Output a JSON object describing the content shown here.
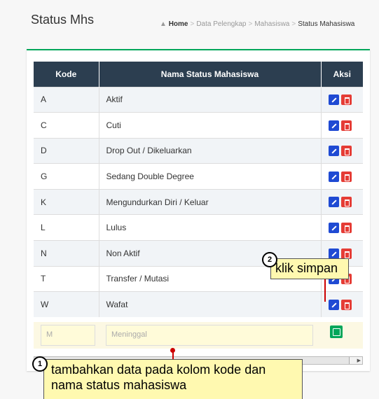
{
  "page": {
    "title": "Status Mhs"
  },
  "breadcrumb": [
    "Home",
    "Data Pelengkap",
    "Mahasiswa",
    "Status Mahasiswa"
  ],
  "table": {
    "headers": [
      "Kode",
      "Nama Status Mahasiswa",
      "Aksi"
    ],
    "rows": [
      {
        "kode": "A",
        "nama": "Aktif"
      },
      {
        "kode": "C",
        "nama": "Cuti"
      },
      {
        "kode": "D",
        "nama": "Drop Out / Dikeluarkan"
      },
      {
        "kode": "G",
        "nama": "Sedang Double Degree"
      },
      {
        "kode": "K",
        "nama": "Mengundurkan Diri / Keluar"
      },
      {
        "kode": "L",
        "nama": "Lulus"
      },
      {
        "kode": "N",
        "nama": "Non Aktif"
      },
      {
        "kode": "T",
        "nama": "Transfer / Mutasi"
      },
      {
        "kode": "W",
        "nama": "Wafat"
      }
    ]
  },
  "new_row": {
    "kode_value": "M",
    "nama_value": "Meninggal"
  },
  "callouts": {
    "step1_num": "1",
    "step1_text": "tambahkan data pada kolom kode dan nama status mahasiswa",
    "step2_num": "2",
    "step2_text": "klik simpan"
  },
  "colors": {
    "header": "#2c3e50",
    "edit": "#1f4ad3",
    "delete": "#e53c35",
    "save": "#00a65a",
    "accent": "#00a65a"
  }
}
